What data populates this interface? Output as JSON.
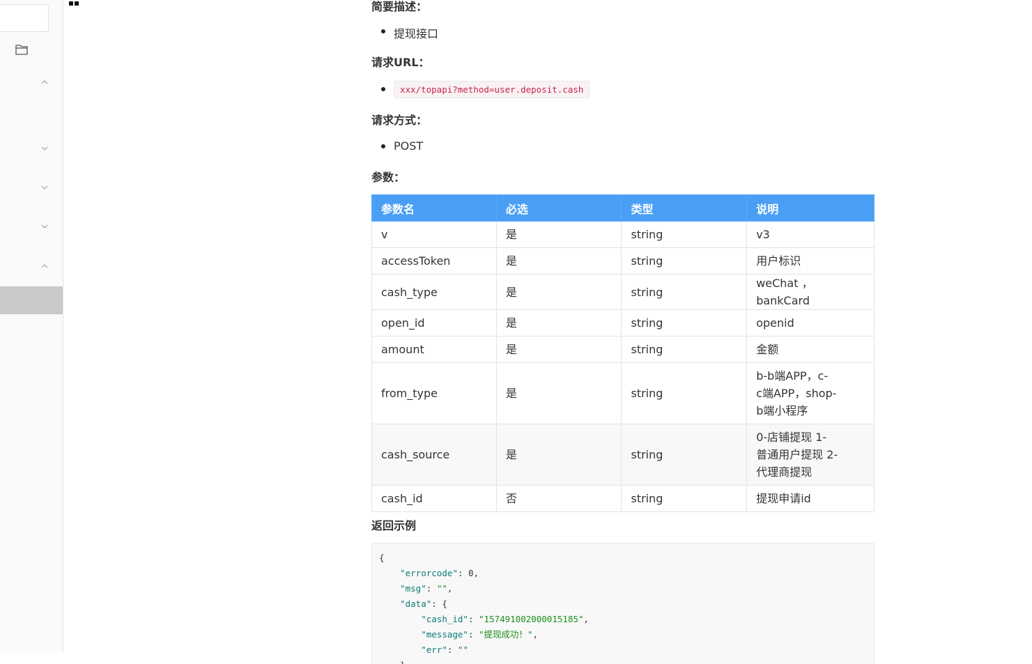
{
  "sidebar": {
    "search": {
      "placeholder": ""
    }
  },
  "content": {
    "desc_heading": "简要描述：",
    "desc_item": "提现接口",
    "url_heading": "请求URL：",
    "url_value": "xxx/topapi?method=user.deposit.cash",
    "method_heading": "请求方式：",
    "method_value": "POST",
    "params_heading": "参数：",
    "table": {
      "headers": [
        "参数名",
        "必选",
        "类型",
        "说明"
      ],
      "rows": [
        [
          "v",
          "是",
          "string",
          "v3"
        ],
        [
          "accessToken",
          "是",
          "string",
          "用户标识"
        ],
        [
          "cash_type",
          "是",
          "string",
          "weChat ，bankCard"
        ],
        [
          "open_id",
          "是",
          "string",
          "openid"
        ],
        [
          "amount",
          "是",
          "string",
          "金额"
        ],
        [
          "from_type",
          "是",
          "string",
          "b-b端APP，c-c端APP，shop-b端小程序"
        ],
        [
          "cash_source",
          "是",
          "string",
          "0-店铺提现 1-普通用户提现 2-代理商提现"
        ],
        [
          "cash_id",
          "否",
          "string",
          "提现申请id"
        ]
      ],
      "from_type_lines": [
        "b-b端APP，c-",
        "c端APP，shop-",
        "b端小程序"
      ],
      "cash_source_lines": [
        "0-店铺提现 1-",
        "普通用户提现 2-",
        "代理商提现"
      ]
    },
    "return_heading": "返回示例",
    "return_code": {
      "open_brace": "{",
      "errorcode_key": "\"errorcode\"",
      "errorcode_val": "0",
      "msg_key": "\"msg\"",
      "msg_val": "\"\"",
      "data_key": "\"data\"",
      "cash_id_key": "\"cash_id\"",
      "cash_id_val": "\"157491002000015185\"",
      "message_key": "\"message\"",
      "message_val": "\"提现成功！\"",
      "err_key": "\"err\"",
      "err_val": "\"\"",
      "close_inner": "}"
    }
  }
}
